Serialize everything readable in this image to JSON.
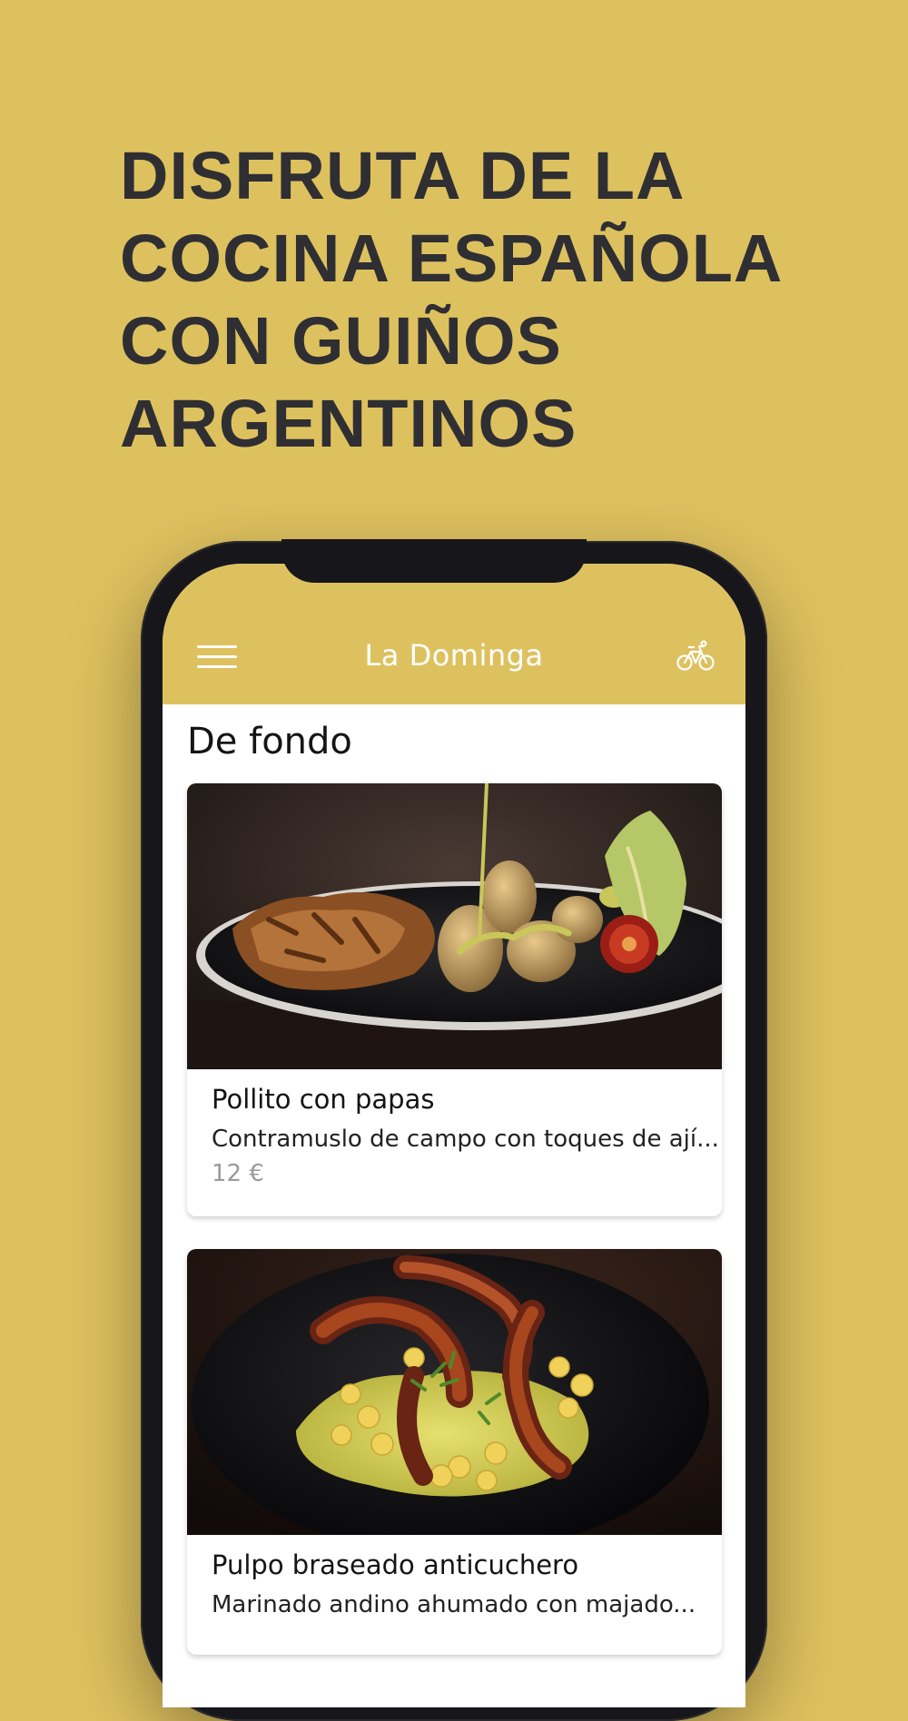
{
  "headline": {
    "lines": [
      "DISFRUTA DE LA",
      "COCINA ESPAÑOLA",
      "CON GUIÑOS",
      "ARGENTINOS"
    ]
  },
  "app": {
    "header": {
      "title": "La Dominga",
      "menu_icon": "hamburger-menu-icon",
      "delivery_icon": "bicycle-icon"
    },
    "section_title": "De fondo",
    "dishes": [
      {
        "name": "Pollito con papas",
        "description": "Contramuslo de campo con toques de ají...",
        "price": "12 €",
        "image": "grilled-chicken-with-potatoes-photo"
      },
      {
        "name": "Pulpo braseado anticuchero",
        "description": "Marinado andino ahumado con majado...",
        "image": "braised-octopus-photo"
      }
    ]
  },
  "colors": {
    "brand_yellow": "#dec15f",
    "headline_text": "#2f2f33",
    "phone_frame": "#17171b",
    "price_text": "#9a9a9a"
  }
}
